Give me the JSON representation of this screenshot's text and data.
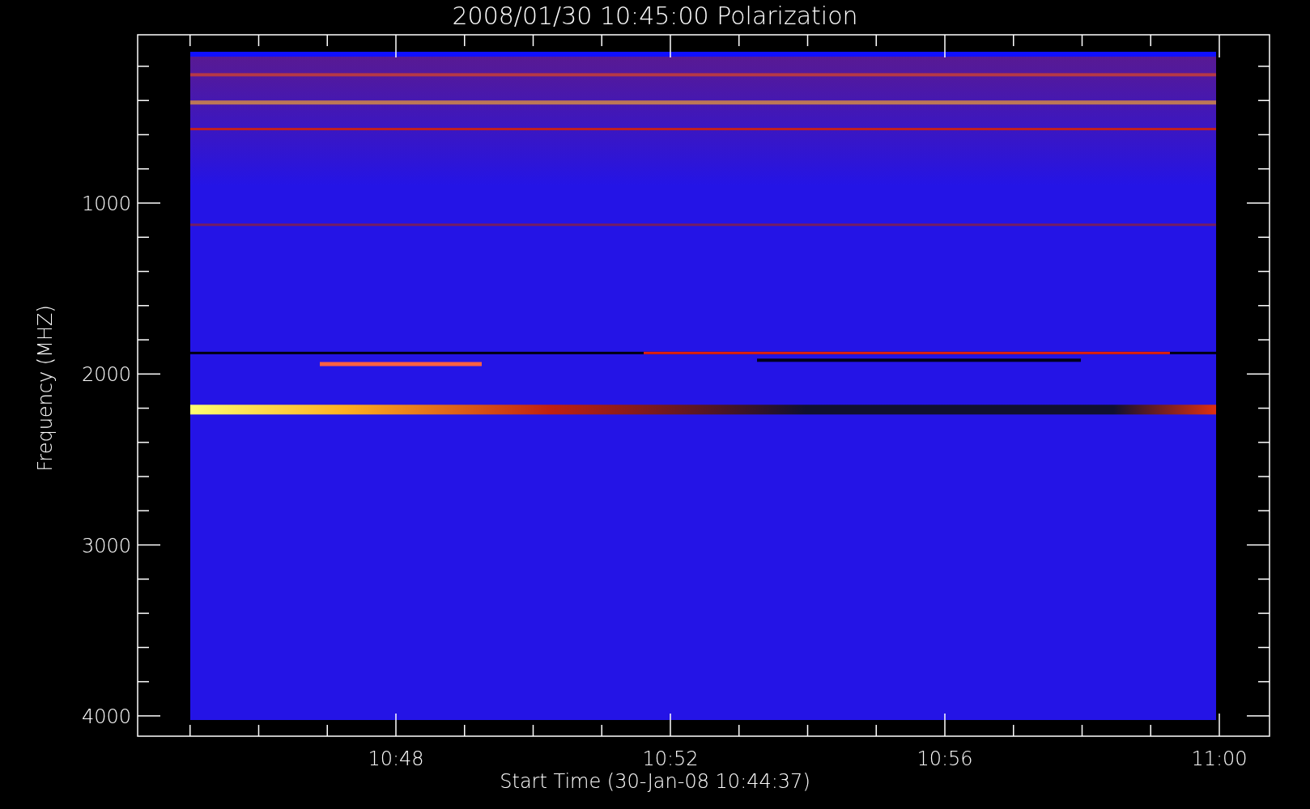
{
  "title": "2008/01/30 10:45:00 Polarization",
  "plot": {
    "y_label": "Frequency (MHZ)",
    "x_label": "Start Time (30-Jan-08 10:44:37)",
    "y_ticks": [
      "1000",
      "2000",
      "3000",
      "4000"
    ],
    "x_ticks": [
      "10:48",
      "10:52",
      "10:56",
      "11:00"
    ]
  }
}
